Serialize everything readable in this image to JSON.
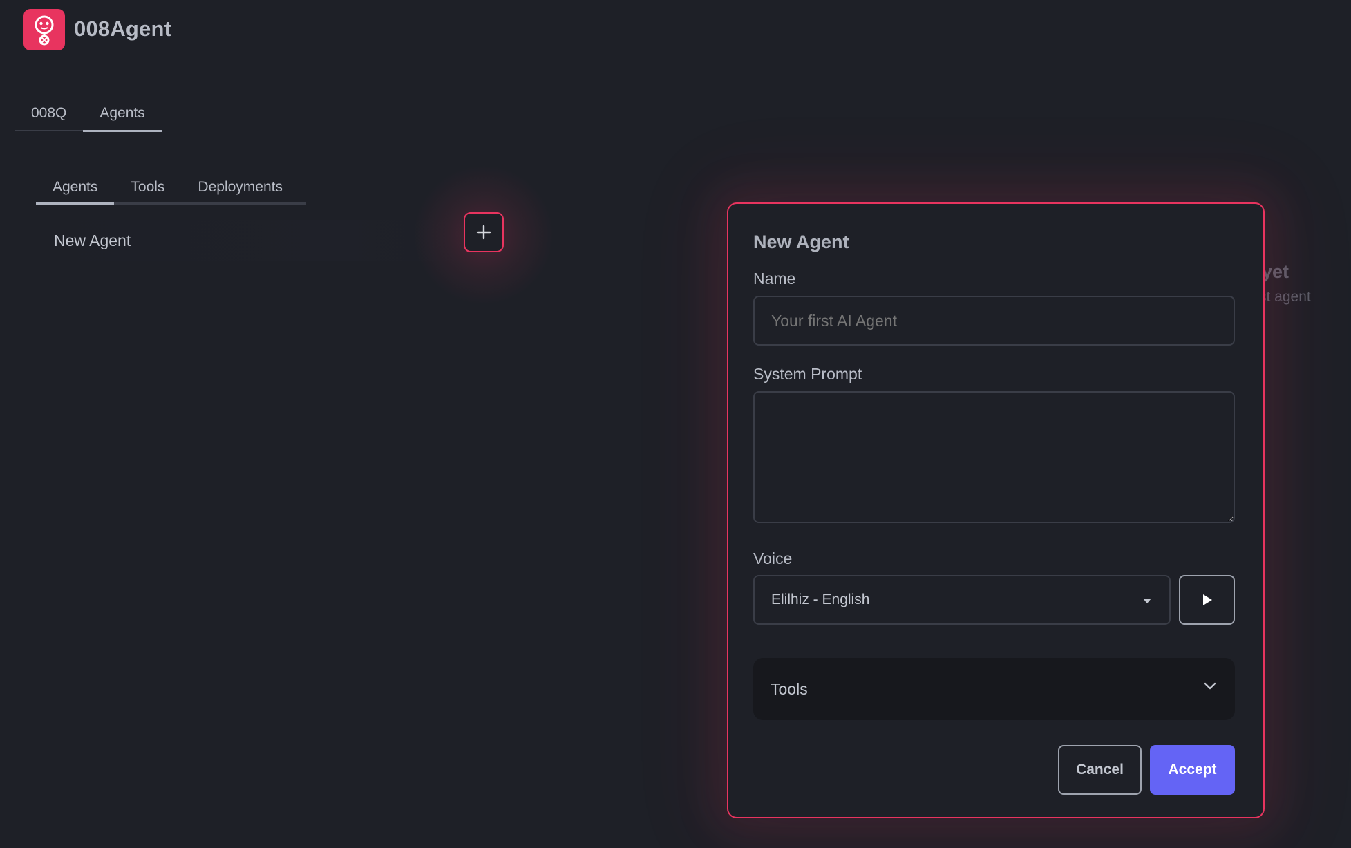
{
  "app": {
    "title": "008Agent",
    "logo_icon": "robot-icon",
    "accent_color": "#e8345f",
    "primary_button_color": "#6464f5"
  },
  "top_tabs": [
    {
      "label": "008Q",
      "active": false
    },
    {
      "label": "Agents",
      "active": true
    }
  ],
  "sub_tabs": [
    {
      "label": "Agents",
      "active": true
    },
    {
      "label": "Tools",
      "active": false
    },
    {
      "label": "Deployments",
      "active": false
    }
  ],
  "agent_list": {
    "items": [
      {
        "label": "New Agent"
      }
    ],
    "add_icon": "plus-icon"
  },
  "empty_state": {
    "title_fragment": "yet",
    "subtitle_fragment": "st agent"
  },
  "modal": {
    "title": "New Agent",
    "name": {
      "label": "Name",
      "placeholder": "Your first AI Agent",
      "value": ""
    },
    "system_prompt": {
      "label": "System Prompt",
      "value": ""
    },
    "voice": {
      "label": "Voice",
      "selected": "Elilhiz - English",
      "play_icon": "play-icon"
    },
    "tools": {
      "label": "Tools",
      "icon": "chevron-down-icon"
    },
    "buttons": {
      "cancel": "Cancel",
      "accept": "Accept"
    }
  }
}
